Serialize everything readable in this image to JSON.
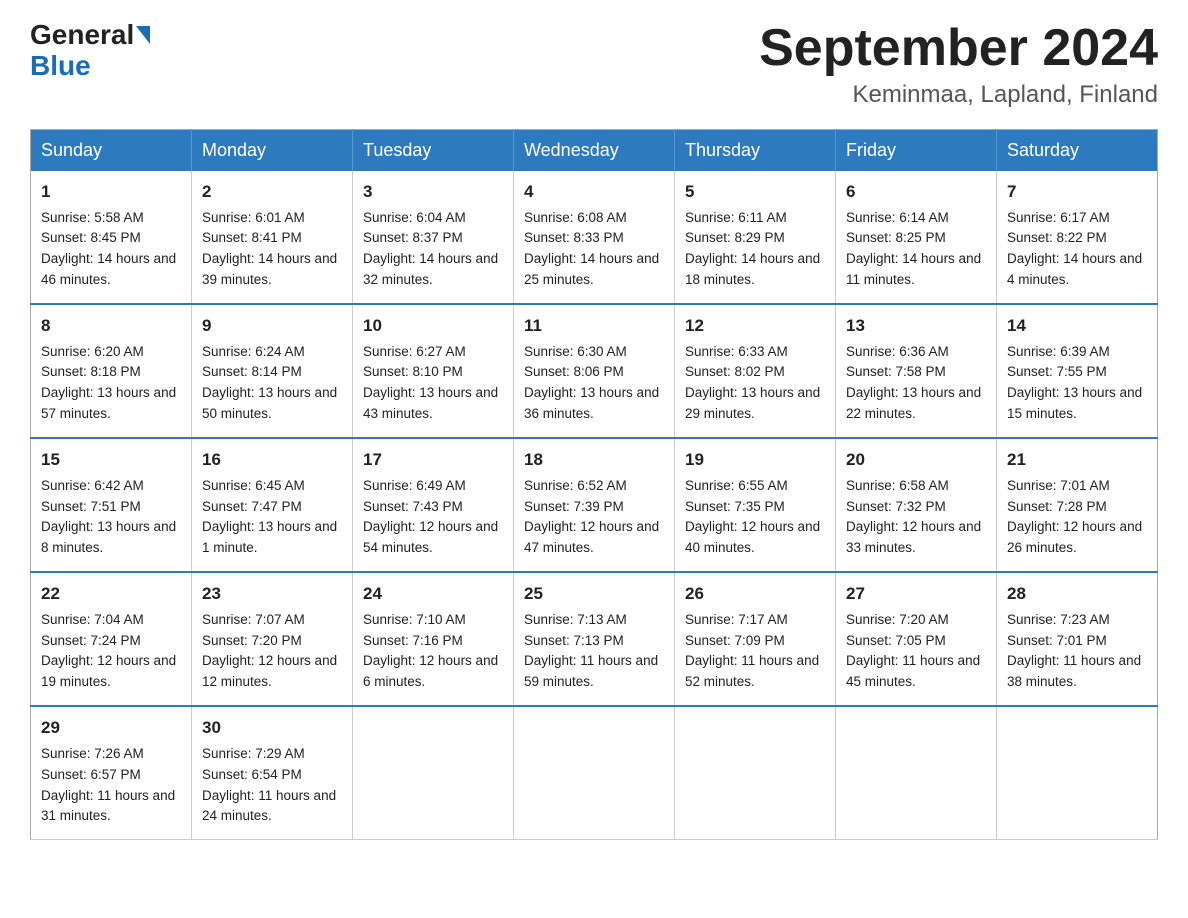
{
  "header": {
    "logo_text1": "General",
    "logo_text2": "Blue",
    "month_title": "September 2024",
    "location": "Keminmaa, Lapland, Finland"
  },
  "days_of_week": [
    "Sunday",
    "Monday",
    "Tuesday",
    "Wednesday",
    "Thursday",
    "Friday",
    "Saturday"
  ],
  "weeks": [
    [
      {
        "day": "1",
        "sunrise": "5:58 AM",
        "sunset": "8:45 PM",
        "daylight": "14 hours and 46 minutes."
      },
      {
        "day": "2",
        "sunrise": "6:01 AM",
        "sunset": "8:41 PM",
        "daylight": "14 hours and 39 minutes."
      },
      {
        "day": "3",
        "sunrise": "6:04 AM",
        "sunset": "8:37 PM",
        "daylight": "14 hours and 32 minutes."
      },
      {
        "day": "4",
        "sunrise": "6:08 AM",
        "sunset": "8:33 PM",
        "daylight": "14 hours and 25 minutes."
      },
      {
        "day": "5",
        "sunrise": "6:11 AM",
        "sunset": "8:29 PM",
        "daylight": "14 hours and 18 minutes."
      },
      {
        "day": "6",
        "sunrise": "6:14 AM",
        "sunset": "8:25 PM",
        "daylight": "14 hours and 11 minutes."
      },
      {
        "day": "7",
        "sunrise": "6:17 AM",
        "sunset": "8:22 PM",
        "daylight": "14 hours and 4 minutes."
      }
    ],
    [
      {
        "day": "8",
        "sunrise": "6:20 AM",
        "sunset": "8:18 PM",
        "daylight": "13 hours and 57 minutes."
      },
      {
        "day": "9",
        "sunrise": "6:24 AM",
        "sunset": "8:14 PM",
        "daylight": "13 hours and 50 minutes."
      },
      {
        "day": "10",
        "sunrise": "6:27 AM",
        "sunset": "8:10 PM",
        "daylight": "13 hours and 43 minutes."
      },
      {
        "day": "11",
        "sunrise": "6:30 AM",
        "sunset": "8:06 PM",
        "daylight": "13 hours and 36 minutes."
      },
      {
        "day": "12",
        "sunrise": "6:33 AM",
        "sunset": "8:02 PM",
        "daylight": "13 hours and 29 minutes."
      },
      {
        "day": "13",
        "sunrise": "6:36 AM",
        "sunset": "7:58 PM",
        "daylight": "13 hours and 22 minutes."
      },
      {
        "day": "14",
        "sunrise": "6:39 AM",
        "sunset": "7:55 PM",
        "daylight": "13 hours and 15 minutes."
      }
    ],
    [
      {
        "day": "15",
        "sunrise": "6:42 AM",
        "sunset": "7:51 PM",
        "daylight": "13 hours and 8 minutes."
      },
      {
        "day": "16",
        "sunrise": "6:45 AM",
        "sunset": "7:47 PM",
        "daylight": "13 hours and 1 minute."
      },
      {
        "day": "17",
        "sunrise": "6:49 AM",
        "sunset": "7:43 PM",
        "daylight": "12 hours and 54 minutes."
      },
      {
        "day": "18",
        "sunrise": "6:52 AM",
        "sunset": "7:39 PM",
        "daylight": "12 hours and 47 minutes."
      },
      {
        "day": "19",
        "sunrise": "6:55 AM",
        "sunset": "7:35 PM",
        "daylight": "12 hours and 40 minutes."
      },
      {
        "day": "20",
        "sunrise": "6:58 AM",
        "sunset": "7:32 PM",
        "daylight": "12 hours and 33 minutes."
      },
      {
        "day": "21",
        "sunrise": "7:01 AM",
        "sunset": "7:28 PM",
        "daylight": "12 hours and 26 minutes."
      }
    ],
    [
      {
        "day": "22",
        "sunrise": "7:04 AM",
        "sunset": "7:24 PM",
        "daylight": "12 hours and 19 minutes."
      },
      {
        "day": "23",
        "sunrise": "7:07 AM",
        "sunset": "7:20 PM",
        "daylight": "12 hours and 12 minutes."
      },
      {
        "day": "24",
        "sunrise": "7:10 AM",
        "sunset": "7:16 PM",
        "daylight": "12 hours and 6 minutes."
      },
      {
        "day": "25",
        "sunrise": "7:13 AM",
        "sunset": "7:13 PM",
        "daylight": "11 hours and 59 minutes."
      },
      {
        "day": "26",
        "sunrise": "7:17 AM",
        "sunset": "7:09 PM",
        "daylight": "11 hours and 52 minutes."
      },
      {
        "day": "27",
        "sunrise": "7:20 AM",
        "sunset": "7:05 PM",
        "daylight": "11 hours and 45 minutes."
      },
      {
        "day": "28",
        "sunrise": "7:23 AM",
        "sunset": "7:01 PM",
        "daylight": "11 hours and 38 minutes."
      }
    ],
    [
      {
        "day": "29",
        "sunrise": "7:26 AM",
        "sunset": "6:57 PM",
        "daylight": "11 hours and 31 minutes."
      },
      {
        "day": "30",
        "sunrise": "7:29 AM",
        "sunset": "6:54 PM",
        "daylight": "11 hours and 24 minutes."
      },
      null,
      null,
      null,
      null,
      null
    ]
  ],
  "labels": {
    "sunrise": "Sunrise:",
    "sunset": "Sunset:",
    "daylight": "Daylight:"
  }
}
